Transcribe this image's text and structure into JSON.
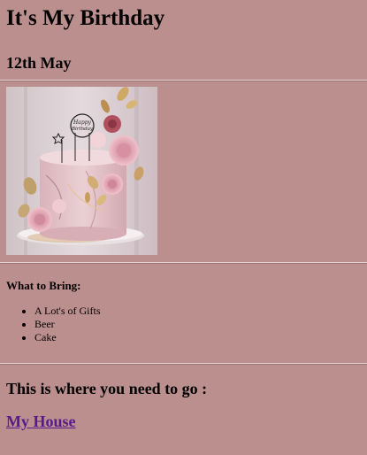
{
  "header": {
    "title": "It's My Birthday",
    "date": "12th May"
  },
  "image": {
    "topper_line1": "Happy",
    "topper_line2": "Birthday"
  },
  "bring": {
    "heading": "What to Bring:",
    "items": [
      "A Lot's of Gifts",
      "Beer",
      "Cake"
    ]
  },
  "location": {
    "heading": "This is where you need to go :",
    "link_label": "My House"
  }
}
